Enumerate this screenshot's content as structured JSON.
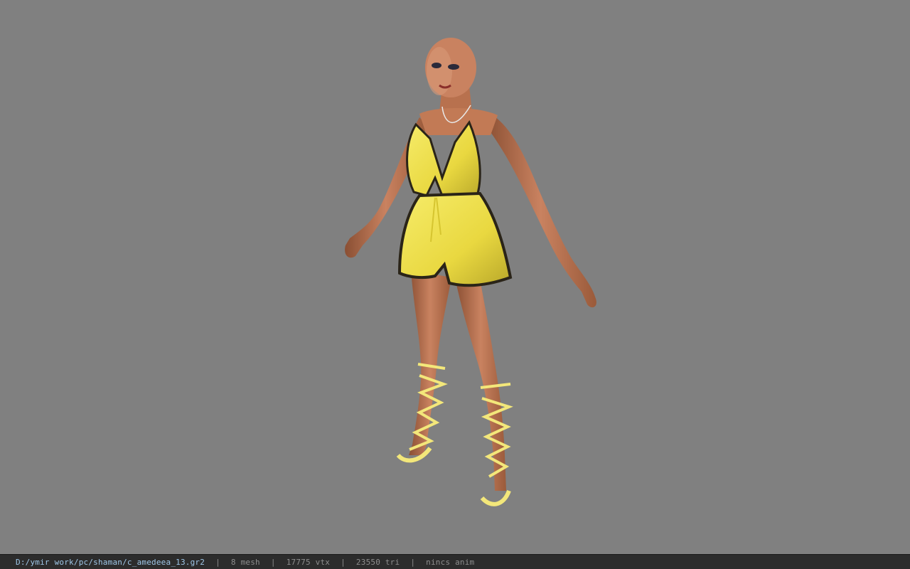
{
  "viewport": {
    "background_color": "#808080",
    "model": {
      "description_icon": "character-model-icon",
      "colors": {
        "skin": "#c27a55",
        "skin_shadow": "#8a4f33",
        "outfit": "#f0e24a",
        "outfit_shadow": "#b9a82a",
        "lace": "#2a2418",
        "sandal": "#f3e77a"
      }
    }
  },
  "status_bar": {
    "file_path": "D:/ymir work/pc/shaman/c_amedeea_13.gr2",
    "separator": "|",
    "mesh_count": "8 mesh",
    "vertex_count": "17775 vtx",
    "triangle_count": "23550 tri",
    "anim_status": "nincs anim",
    "path_color": "#9fc7e8",
    "text_color": "#8e8e8e"
  }
}
